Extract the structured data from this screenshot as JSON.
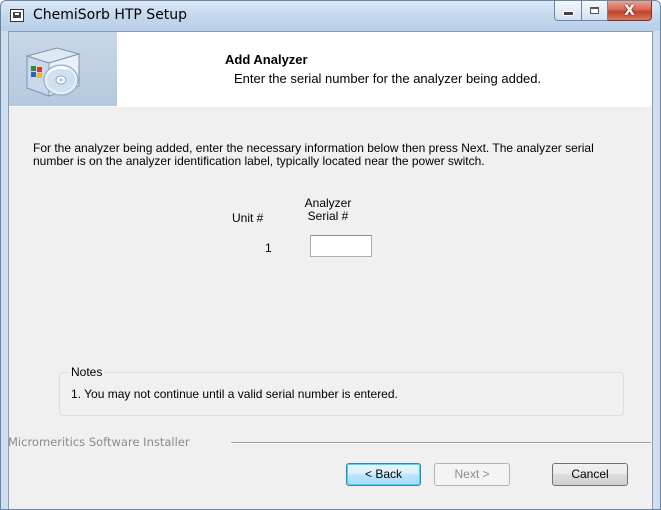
{
  "window": {
    "title": "ChemiSorb HTP Setup",
    "close_glyph": "X"
  },
  "header": {
    "title": "Add Analyzer",
    "subtitle": "Enter the serial number for the analyzer being added."
  },
  "main": {
    "description": "For the analyzer being added, enter the necessary information below then press Next. The analyzer serial number is on the analyzer identification label, typically located near the power switch.",
    "table": {
      "col_unit": "Unit #",
      "col_serial_line1": "Analyzer",
      "col_serial_line2": "Serial #",
      "rows": [
        {
          "unit": "1",
          "serial": ""
        }
      ]
    },
    "notes": {
      "legend": "Notes",
      "items": [
        "1.  You may not continue until a valid serial number is entered."
      ]
    }
  },
  "footer": {
    "brand": "Micromeritics Software Installer",
    "back_label": "< Back",
    "next_label": "Next >",
    "cancel_label": "Cancel"
  },
  "icons": {
    "app": "setup-app-icon",
    "header_graphic": "installer-box-cd-icon",
    "minimize": "minimize-icon",
    "maximize": "maximize-icon",
    "close": "close-icon"
  },
  "colors": {
    "titlebar": "#c4d8ee",
    "close_button": "#c2412a",
    "client_bg": "#f0f0f0",
    "header_bg": "#ffffff",
    "default_button_border": "#3c7fb1",
    "disabled_text": "#8d8d8d"
  }
}
